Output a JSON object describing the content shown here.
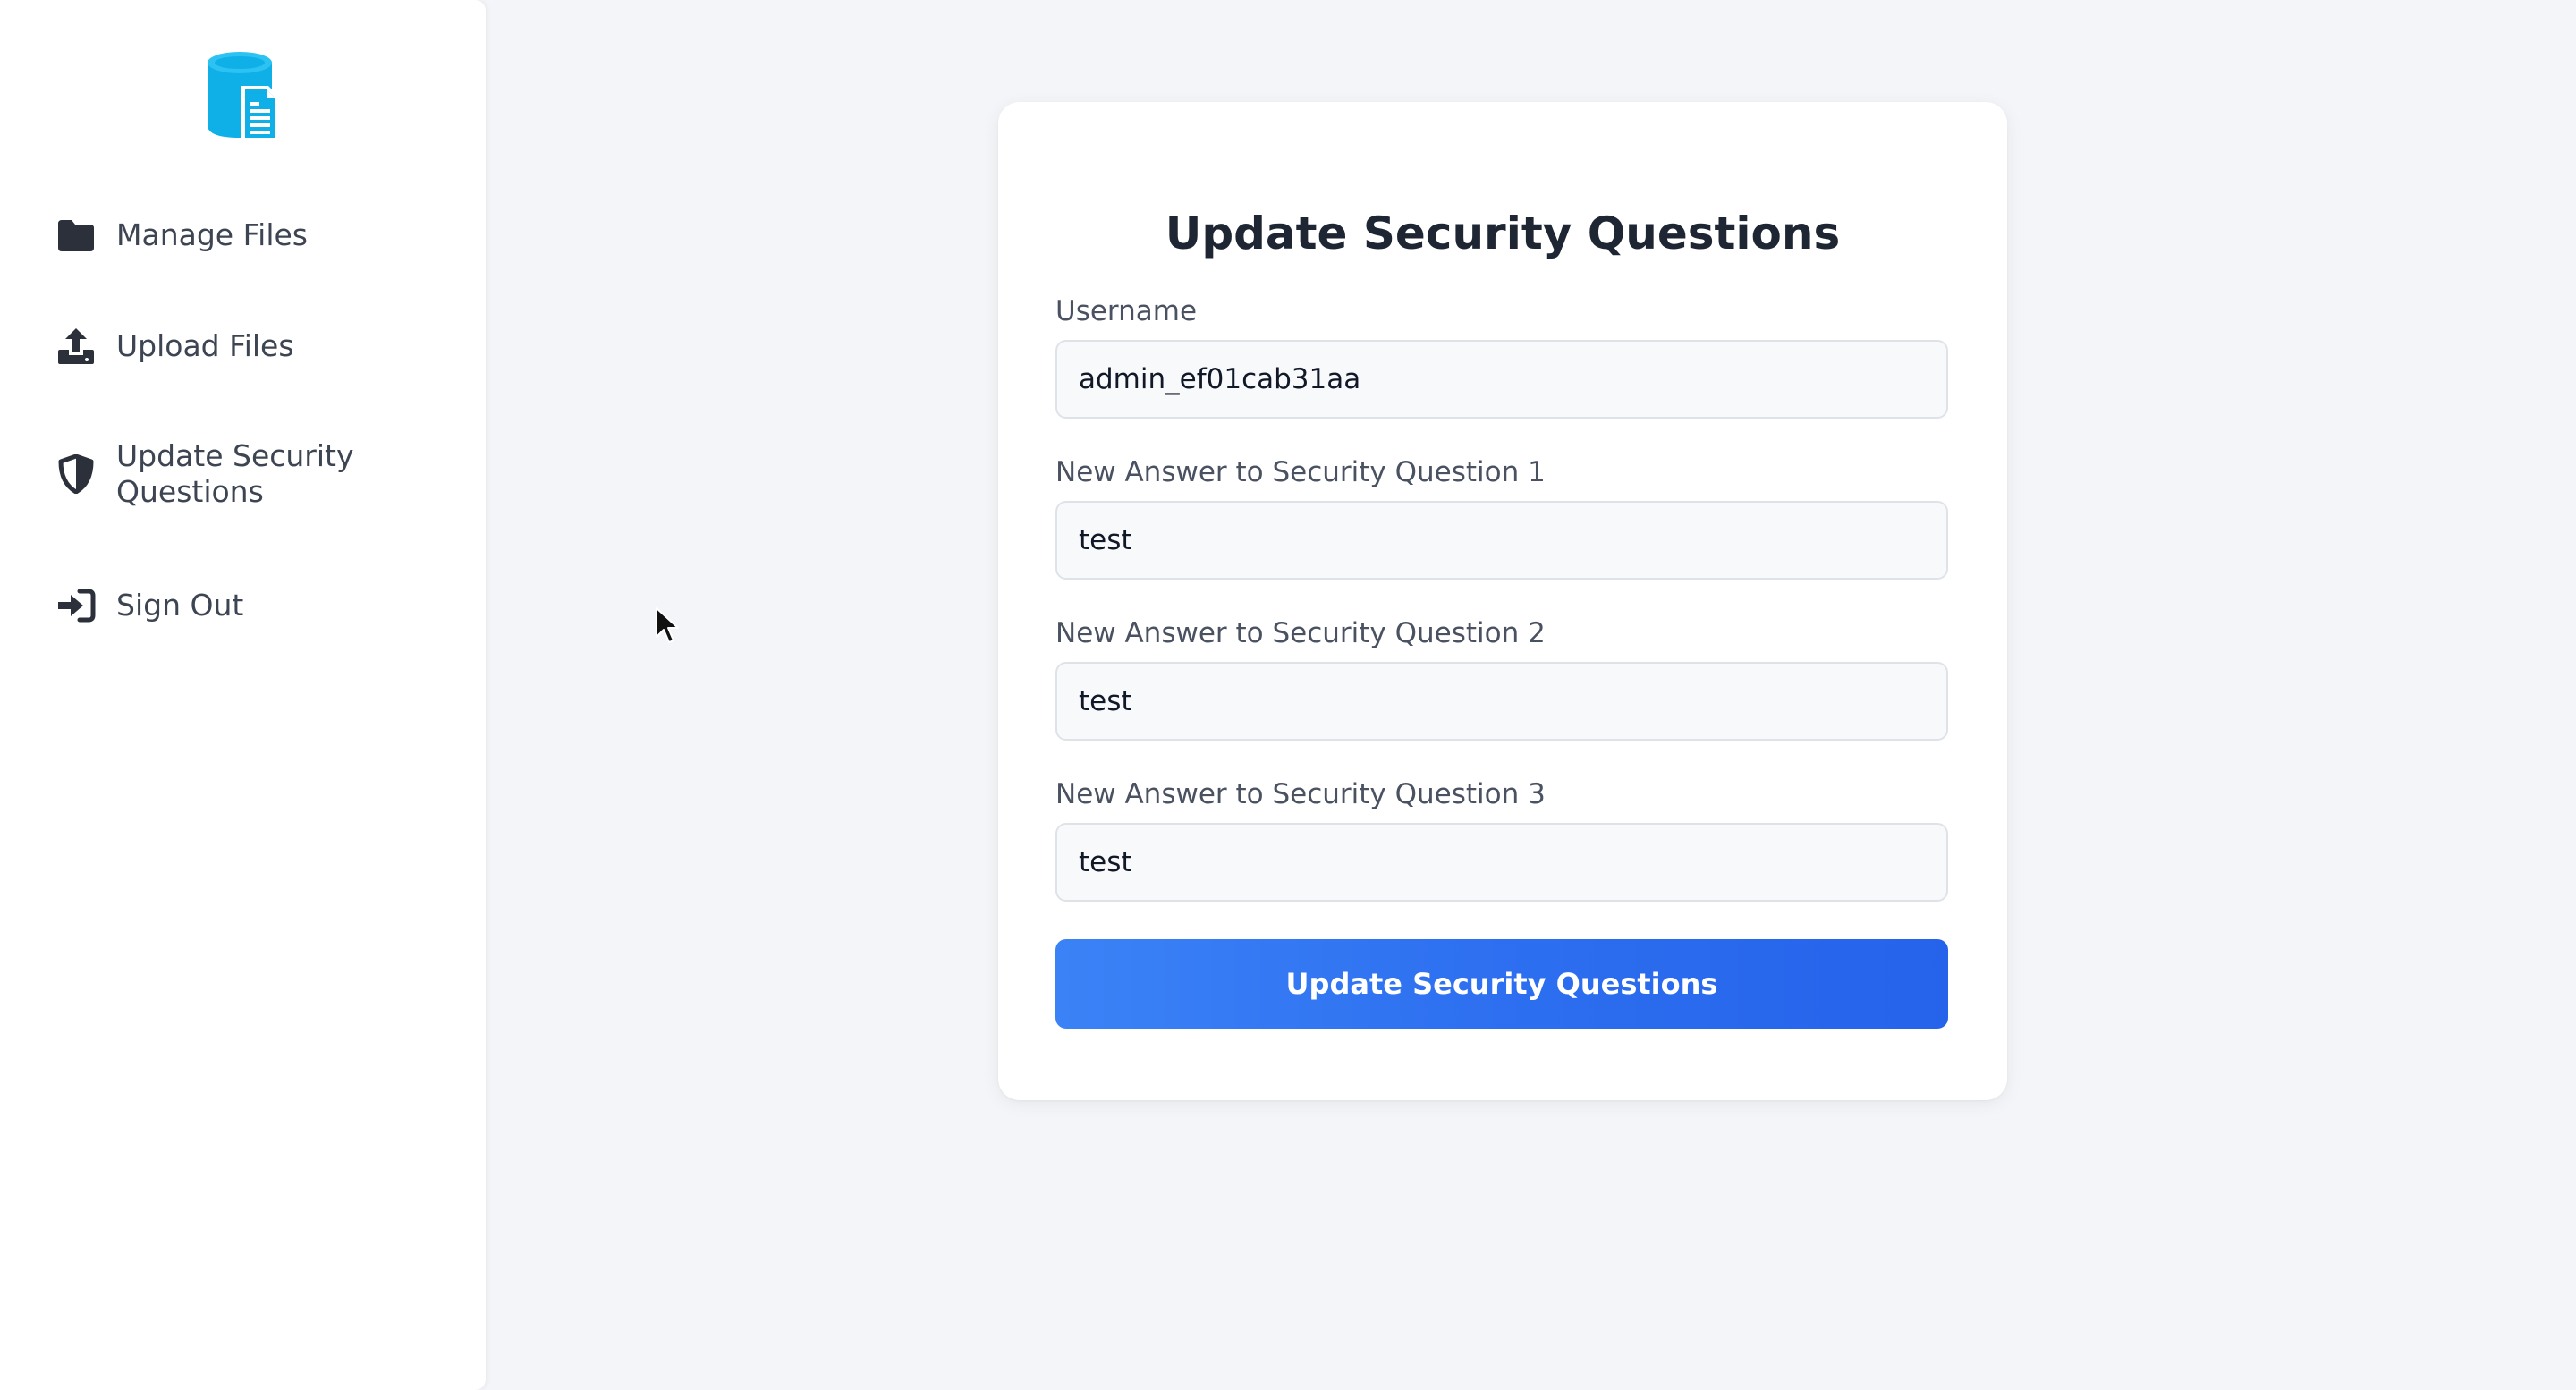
{
  "sidebar": {
    "logo_icon": "file-storage-icon",
    "items": [
      {
        "label": "Manage Files",
        "icon": "folder-icon"
      },
      {
        "label": "Upload Files",
        "icon": "upload-icon"
      },
      {
        "label": "Update Security Questions",
        "icon": "shield-icon"
      },
      {
        "label": "Sign Out",
        "icon": "sign-out-icon"
      }
    ]
  },
  "form": {
    "title": "Update Security Questions",
    "username": {
      "label": "Username",
      "value": "admin_ef01cab31aa"
    },
    "answer1": {
      "label": "New Answer to Security Question 1",
      "value": "test"
    },
    "answer2": {
      "label": "New Answer to Security Question 2",
      "value": "test"
    },
    "answer3": {
      "label": "New Answer to Security Question 3",
      "value": "test"
    },
    "submit_label": "Update Security Questions"
  },
  "colors": {
    "accent": "#2563eb",
    "logo": "#0ea5e9",
    "background": "#f3f5f8"
  }
}
